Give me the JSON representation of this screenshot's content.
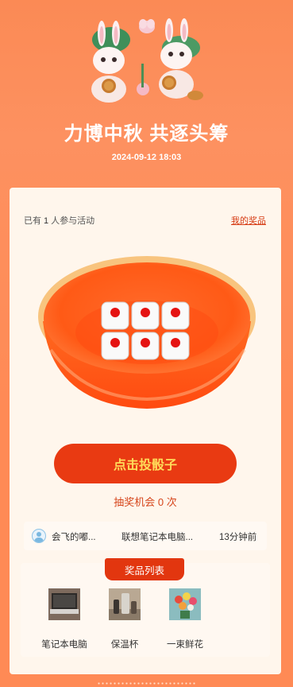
{
  "header": {
    "title": "力博中秋 共逐头筹",
    "datetime": "2024-09-12 18:03"
  },
  "stats": {
    "prefix": "已有",
    "count": "1",
    "suffix": "人参与活动",
    "my_prizes_link": "我的奖品"
  },
  "action": {
    "roll_button": "点击投骰子",
    "chances_label": "抽奖机会 0 次"
  },
  "winner": {
    "name": "会飞的嘟...",
    "prize": "联想笔记本电脑...",
    "time": "13分钟前"
  },
  "prizes": {
    "tab_label": "奖品列表",
    "items": [
      {
        "label": "笔记本电脑",
        "icon": "laptop-icon"
      },
      {
        "label": "保温杯",
        "icon": "thermos-icon"
      },
      {
        "label": "一束鲜花",
        "icon": "bouquet-icon"
      }
    ]
  },
  "colors": {
    "accent": "#e93a12",
    "button_text": "#ffdc5a",
    "background": "#ff8a55",
    "card": "#fff6ec"
  }
}
